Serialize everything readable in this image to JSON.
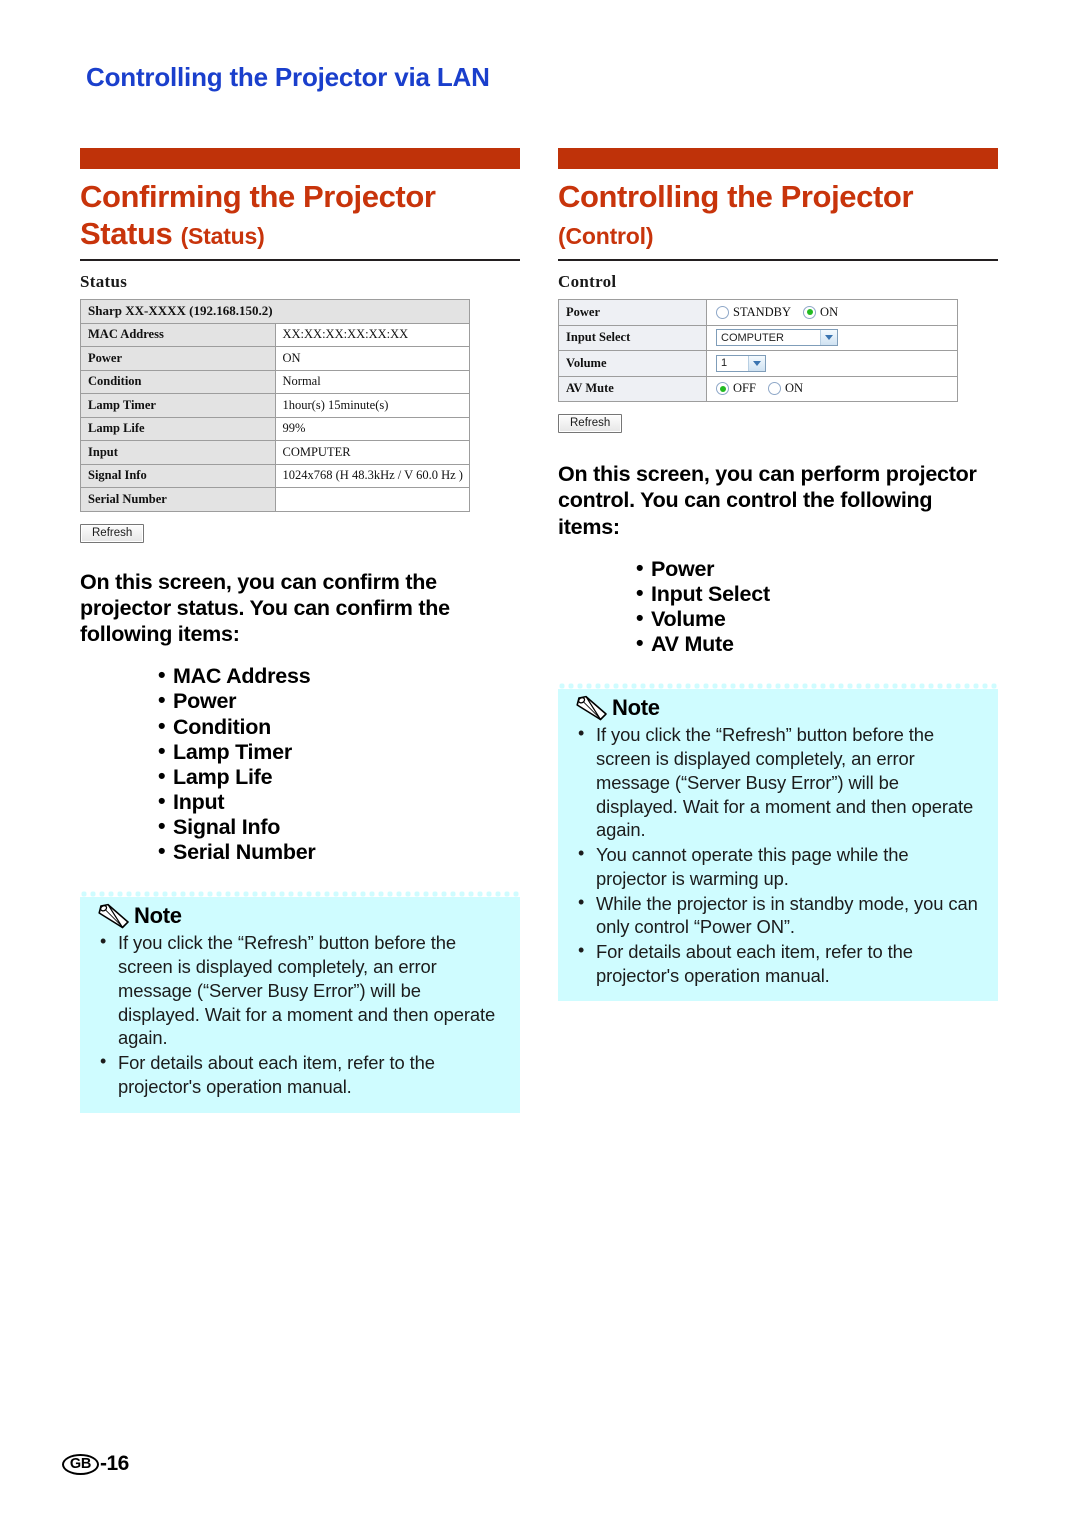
{
  "running_head": "Controlling the Projector via LAN",
  "accent_bar_color": "#bf3209",
  "section_title_color": "#c8340b",
  "running_head_color": "#1a3fcc",
  "note_background_color": "#cffcff",
  "left_column": {
    "title_main": "Confirming the Projector Status",
    "title_sub": "(Status)",
    "panel_caption": "Status",
    "status_table": {
      "device_header": "Sharp XX-XXXX (192.168.150.2)",
      "rows": [
        {
          "label": "MAC Address",
          "value": "XX:XX:XX:XX:XX:XX"
        },
        {
          "label": "Power",
          "value": "ON"
        },
        {
          "label": "Condition",
          "value": "Normal"
        },
        {
          "label": "Lamp Timer",
          "value": "1hour(s) 15minute(s)"
        },
        {
          "label": "Lamp Life",
          "value": "99%"
        },
        {
          "label": "Input",
          "value": "COMPUTER"
        },
        {
          "label": "Signal Info",
          "value": "1024x768  (H  48.3kHz  / V  60.0 Hz )"
        },
        {
          "label": "Serial Number",
          "value": ""
        }
      ]
    },
    "refresh_label": "Refresh",
    "lead": "On this screen, you can confirm the projector status. You can confirm the following items:",
    "items": [
      "MAC Address",
      "Power",
      "Condition",
      "Lamp Timer",
      "Lamp Life",
      "Input",
      "Signal Info",
      "Serial Number"
    ],
    "note": {
      "heading": "Note",
      "bullets": [
        "If you click the “Refresh” button before the screen is displayed completely, an error message (“Server Busy Error”) will be displayed. Wait for a moment and then operate again.",
        "For details about each item, refer to the projector's operation manual."
      ]
    }
  },
  "right_column": {
    "title_main": "Controlling the Projector",
    "title_sub": "(Control)",
    "panel_caption": "Control",
    "control_table": {
      "rows": [
        {
          "label": "Power",
          "type": "radio",
          "options": [
            {
              "text": "STANDBY",
              "selected": false
            },
            {
              "text": "ON",
              "selected": true
            }
          ]
        },
        {
          "label": "Input Select",
          "type": "select",
          "value": "COMPUTER"
        },
        {
          "label": "Volume",
          "type": "select",
          "value": "1"
        },
        {
          "label": "AV Mute",
          "type": "radio",
          "options": [
            {
              "text": "OFF",
              "selected": true
            },
            {
              "text": "ON",
              "selected": false
            }
          ]
        }
      ]
    },
    "refresh_label": "Refresh",
    "lead": "On this screen, you can perform projector control. You can control the following items:",
    "items": [
      "Power",
      "Input Select",
      "Volume",
      "AV Mute"
    ],
    "note": {
      "heading": "Note",
      "bullets": [
        "If you click the “Refresh” button before the screen is displayed completely, an error message (“Server Busy Error”) will be displayed. Wait for a moment and then operate again.",
        "You cannot operate this page while the projector is warming up.",
        "While the projector is in standby mode, you can only control “Power ON”.",
        "For details about each item, refer to the projector's operation manual."
      ]
    }
  },
  "footer": {
    "region_code": "GB",
    "page_number": "-16"
  }
}
